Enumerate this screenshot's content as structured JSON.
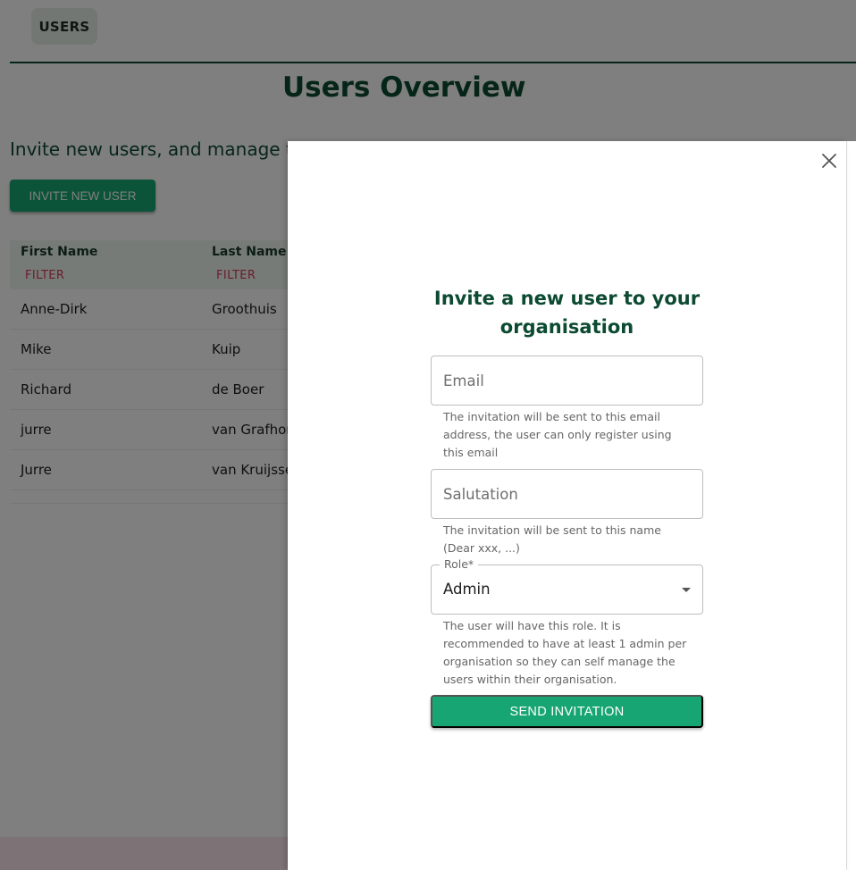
{
  "nav": {
    "users_tab": "USERS"
  },
  "page": {
    "title": "Users Overview",
    "subtitle": "Invite new users, and manage t",
    "invite_button": "INVITE NEW USER"
  },
  "table": {
    "columns": [
      {
        "label": "First Name",
        "filter": "FILTER"
      },
      {
        "label": "Last Name",
        "filter": "FILTER"
      }
    ],
    "rows": [
      [
        "Anne-Dirk",
        "Groothuis"
      ],
      [
        "Mike",
        "Kuip"
      ],
      [
        "Richard",
        "de Boer"
      ],
      [
        "jurre",
        "van Grafhors"
      ],
      [
        "Jurre",
        "van Kruijsse"
      ]
    ]
  },
  "drawer": {
    "title": "Invite a new user to your organisation",
    "email": {
      "placeholder": "Email",
      "helper": "The invitation will be sent to this email address, the user can only register using this email"
    },
    "salutation": {
      "placeholder": "Salutation",
      "helper": "The invitation will be sent to this name (Dear xxx, ...)"
    },
    "role": {
      "label": "Role*",
      "value": "Admin",
      "helper": "The user will have this role. It is recommended to have at least 1 admin per organisation so they can self manage the users within their organisation."
    },
    "send_button": "SEND INVITATION"
  },
  "colors": {
    "primary": "#17a673",
    "heading": "#0c4a32",
    "filter": "#d43a56",
    "overlay": "rgba(0,0,0,0.5)"
  }
}
